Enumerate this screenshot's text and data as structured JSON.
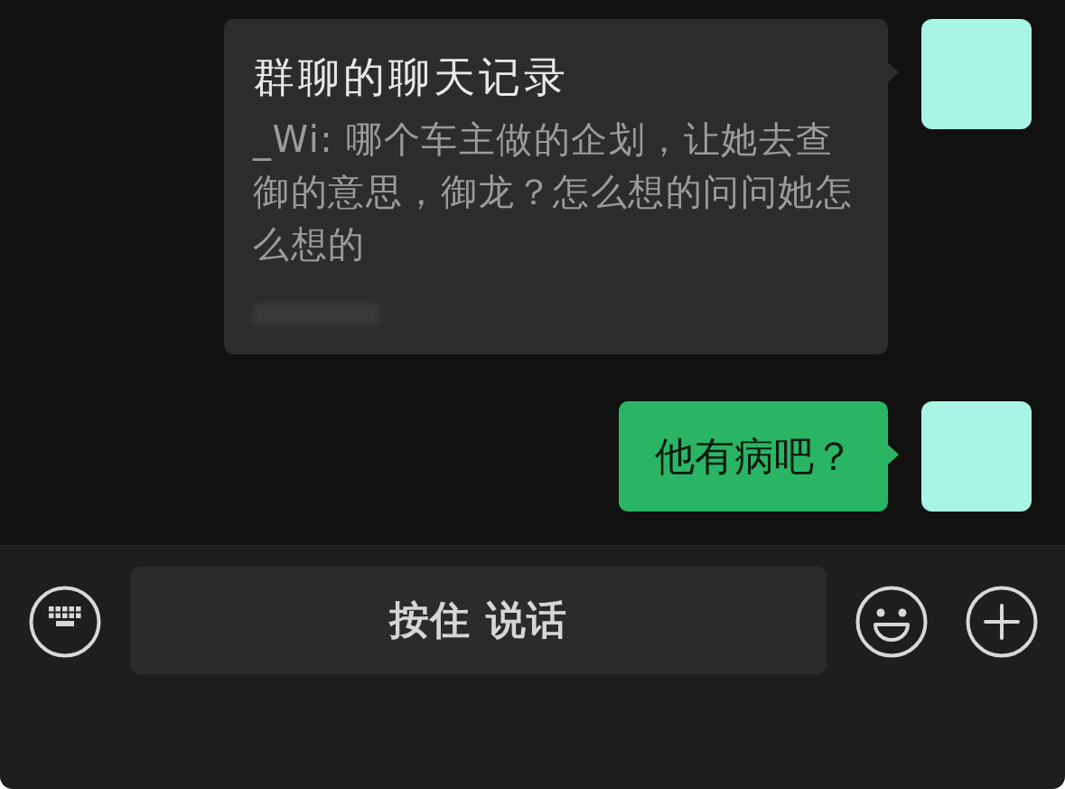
{
  "messages": [
    {
      "kind": "chat_record",
      "title": "群聊的聊天记录",
      "preview": "_Wi: 哪个车主做的企划，让她去查御的意思，御龙？怎么想的问问她怎么想的"
    },
    {
      "kind": "text",
      "text": "他有病吧？"
    }
  ],
  "input_bar": {
    "voice_button": "按住 说话"
  }
}
